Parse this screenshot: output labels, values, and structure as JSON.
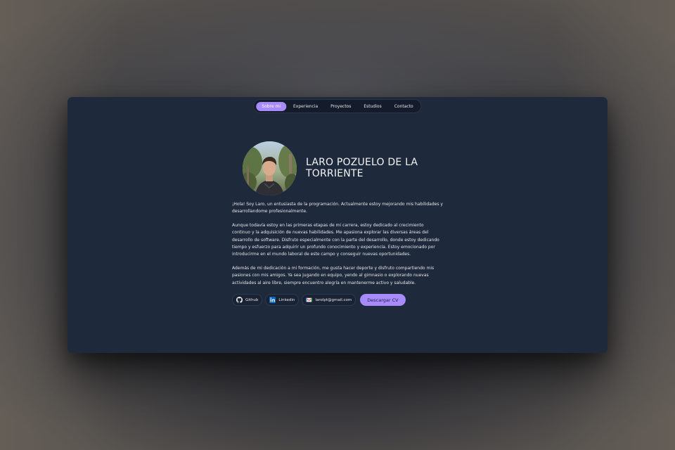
{
  "nav": {
    "items": [
      {
        "label": "Sobre mi",
        "active": true
      },
      {
        "label": "Experiencia",
        "active": false
      },
      {
        "label": "Proyectos",
        "active": false
      },
      {
        "label": "Estudios",
        "active": false
      },
      {
        "label": "Contacto",
        "active": false
      }
    ]
  },
  "profile": {
    "name": "LARO POZUELO DE LA TORRIENTE"
  },
  "about": {
    "paragraphs": [
      "¡Hola! Soy Laro, un entusiasta de la programación. Actualmente estoy mejorando mis habilidades y desarrollandome profesionalmente.",
      "Aunque todavía estoy en las primeras etapas de mi carrera, estoy dedicado al crecimiento continuo y la adquisición de nuevas habilidades. Me apasiona explorar las diversas áreas del desarrollo de software. Disfruto especialmente con la parte del desarrollo, donde estoy dedicando tiempo y esfuerzo para adquirir un profundo conocimiento y experiencia. Estoy emocionado por introducirme en el mundo laboral de este campo y conseguir nuevas oportunidades.",
      "Además de mi dedicación a mi formación, me gusta hacer deporte y disfruto compartiendo mis pasiones con mis amigos. Ya sea jugando en equipo, yendo al gimnasio o explorando nuevas actividades al aire libre, siempre encuentro alegría en mantenerme activo y saludable."
    ]
  },
  "links": {
    "github_label": "Github",
    "linkedin_label": "Linkedin",
    "email_label": "larolpt@gmail.com",
    "cv_label": "Descargar CV"
  },
  "icons": {
    "github": "github-icon",
    "linkedin": "linkedin-icon",
    "email": "gmail-icon"
  },
  "colors": {
    "accent": "#a78bfa",
    "panel": "#1e293b",
    "linkedin": "#0a66c2"
  }
}
